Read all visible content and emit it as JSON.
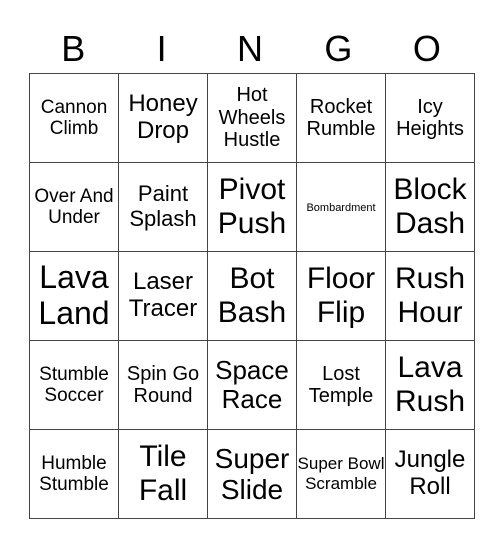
{
  "header": [
    "B",
    "I",
    "N",
    "G",
    "O"
  ],
  "rows": [
    [
      "Cannon Climb",
      "Honey Drop",
      "Hot Wheels Hustle",
      "Rocket Rumble",
      "Icy Heights"
    ],
    [
      "Over And Under",
      "Paint Splash",
      "Pivot Push",
      "Bombardment",
      "Block Dash"
    ],
    [
      "Lava Land",
      "Laser Tracer",
      "Bot Bash",
      "Floor Flip",
      "Rush Hour"
    ],
    [
      "Stumble Soccer",
      "Spin Go Round",
      "Space Race",
      "Lost Temple",
      "Lava Rush"
    ],
    [
      "Humble Stumble",
      "Tile Fall",
      "Super Slide",
      "Super Bowl Scramble",
      "Jungle Roll"
    ]
  ]
}
